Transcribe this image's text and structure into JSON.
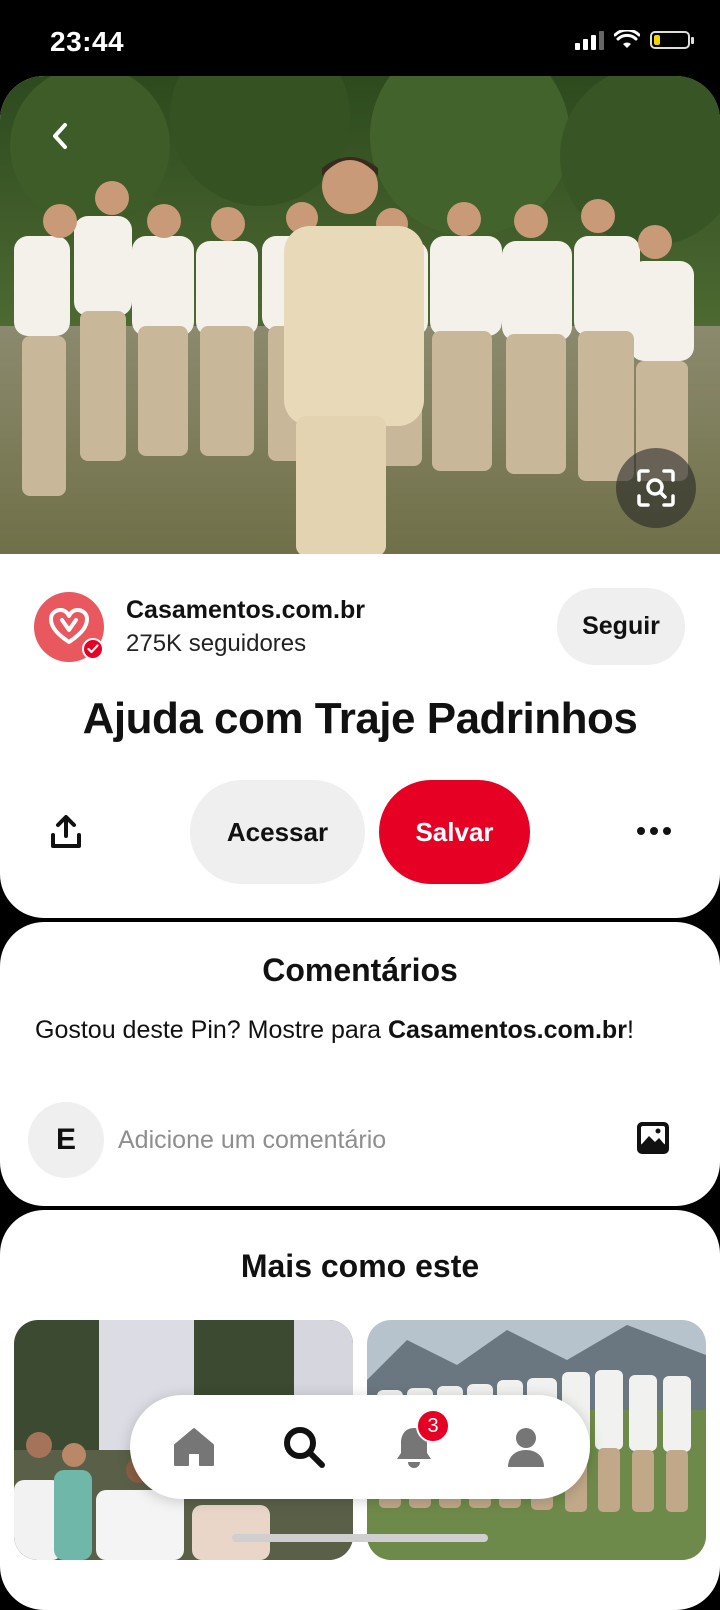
{
  "status_bar": {
    "time": "23:44"
  },
  "pin": {
    "creator_name": "Casamentos.com.br",
    "followers": "275K seguidores",
    "follow_label": "Seguir",
    "title": "Ajuda com Traje Padrinhos",
    "visit_label": "Acessar",
    "save_label": "Salvar"
  },
  "comments": {
    "heading": "Comentários",
    "prompt_text": "Gostou deste Pin? Mostre para ",
    "prompt_creator": "Casamentos.com.br",
    "prompt_suffix": "!",
    "avatar_initial": "E",
    "input_placeholder": "Adicione um comentário"
  },
  "related": {
    "heading": "Mais como este"
  },
  "bottom_nav": {
    "items": [
      "home-icon",
      "search-icon",
      "bell-icon",
      "profile-icon"
    ],
    "notifications_count": "3",
    "active": "search"
  },
  "colors": {
    "brand_red": "#e60023",
    "button_gray": "#efefef",
    "logo_pink": "#e9575f"
  }
}
